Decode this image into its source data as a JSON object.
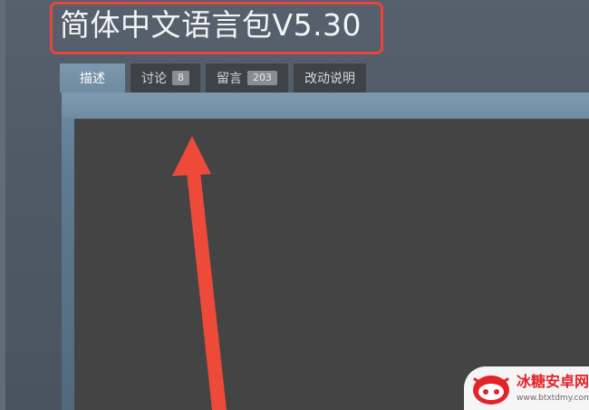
{
  "header": {
    "title": "简体中文语言包V5.30"
  },
  "tabs": [
    {
      "label": "描述",
      "active": true
    },
    {
      "label": "讨论",
      "badge": "8"
    },
    {
      "label": "留言",
      "badge": "203"
    },
    {
      "label": "改动说明"
    }
  ],
  "watermark": {
    "title": "冰糖安卓网",
    "url": "www.btxtdmy.com"
  },
  "colors": {
    "highlight": "#e8453c",
    "active_tab": "#7491a6",
    "panel": "#444444"
  }
}
